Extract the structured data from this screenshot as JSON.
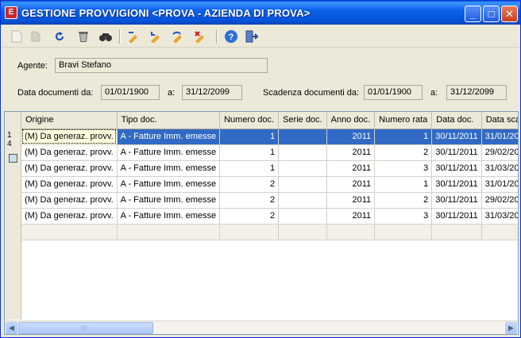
{
  "window": {
    "title": "GESTIONE PROVVIGIONI <PROVA - AZIENDA DI PROVA>",
    "app_icon": "app-icon",
    "buttons": {
      "minimize": "_",
      "maximize": "□",
      "close": "✕"
    }
  },
  "toolbar": {
    "icons": [
      "new-icon",
      "open-icon",
      "refresh-icon",
      "delete-icon",
      "find-icon",
      "edit-icon",
      "edit-down-icon",
      "undo-edit-icon",
      "cancel-edit-icon",
      "help-icon",
      "exit-icon"
    ]
  },
  "form": {
    "agente_label": "Agente:",
    "agente_value": "Bravi Stefano",
    "data_doc_label": "Data documenti da:",
    "data_doc_from": "01/01/1900",
    "a_label": "a:",
    "data_doc_to": "31/12/2099",
    "scadenza_label": "Scadenza documenti da:",
    "scadenza_from": "01/01/1900",
    "a_label2": "a:",
    "scadenza_to": "31/12/2099"
  },
  "grid": {
    "row_header_text": "1\n4",
    "columns": [
      "Origine",
      "Tipo doc.",
      "Numero doc.",
      "Serie doc.",
      "Anno doc.",
      "Numero rata",
      "Data doc.",
      "Data scad"
    ],
    "rows": [
      [
        "(M) Da generaz. provv.",
        "A - Fatture Imm. emesse",
        "1",
        "",
        "2011",
        "1",
        "30/11/2011",
        "31/01/20"
      ],
      [
        "(M) Da generaz. provv.",
        "A - Fatture Imm. emesse",
        "1",
        "",
        "2011",
        "2",
        "30/11/2011",
        "29/02/20"
      ],
      [
        "(M) Da generaz. provv.",
        "A - Fatture Imm. emesse",
        "1",
        "",
        "2011",
        "3",
        "30/11/2011",
        "31/03/20"
      ],
      [
        "(M) Da generaz. provv.",
        "A - Fatture Imm. emesse",
        "2",
        "",
        "2011",
        "1",
        "30/11/2011",
        "31/01/20"
      ],
      [
        "(M) Da generaz. provv.",
        "A - Fatture Imm. emesse",
        "2",
        "",
        "2011",
        "2",
        "30/11/2011",
        "29/02/20"
      ],
      [
        "(M) Da generaz. provv.",
        "A - Fatture Imm. emesse",
        "2",
        "",
        "2011",
        "3",
        "30/11/2011",
        "31/03/20"
      ]
    ],
    "selected_row": 0
  },
  "colors": {
    "selection": "#316ac5",
    "titlebar": "#0b61e8"
  }
}
